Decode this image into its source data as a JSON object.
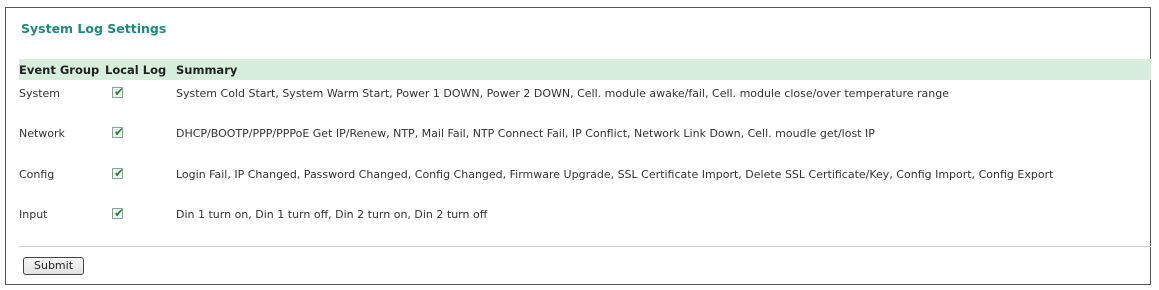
{
  "title": "System Log Settings",
  "columns": {
    "event_group": "Event Group",
    "local_log": "Local Log",
    "summary": "Summary"
  },
  "rows": [
    {
      "group": "System",
      "local_log": true,
      "summary": "System Cold Start, System Warm Start, Power 1 DOWN, Power 2 DOWN, Cell. module awake/fail, Cell. module close/over temperature range"
    },
    {
      "group": "Network",
      "local_log": true,
      "summary": "DHCP/BOOTP/PPP/PPPoE Get IP/Renew, NTP, Mail Fail, NTP Connect Fail, IP Conflict, Network Link Down, Cell. moudle get/lost IP"
    },
    {
      "group": "Config",
      "local_log": true,
      "summary": "Login Fail, IP Changed, Password Changed, Config Changed, Firmware Upgrade, SSL Certificate Import, Delete SSL Certificate/Key, Config Import, Config Export"
    },
    {
      "group": "Input",
      "local_log": true,
      "summary": "Din 1 turn on, Din 1 turn off, Din 2 turn on, Din 2 turn off"
    }
  ],
  "submit_label": "Submit",
  "colors": {
    "title": "#1e8a7c",
    "header_bg": "#d7eedd",
    "check": "#2e7d3a"
  }
}
